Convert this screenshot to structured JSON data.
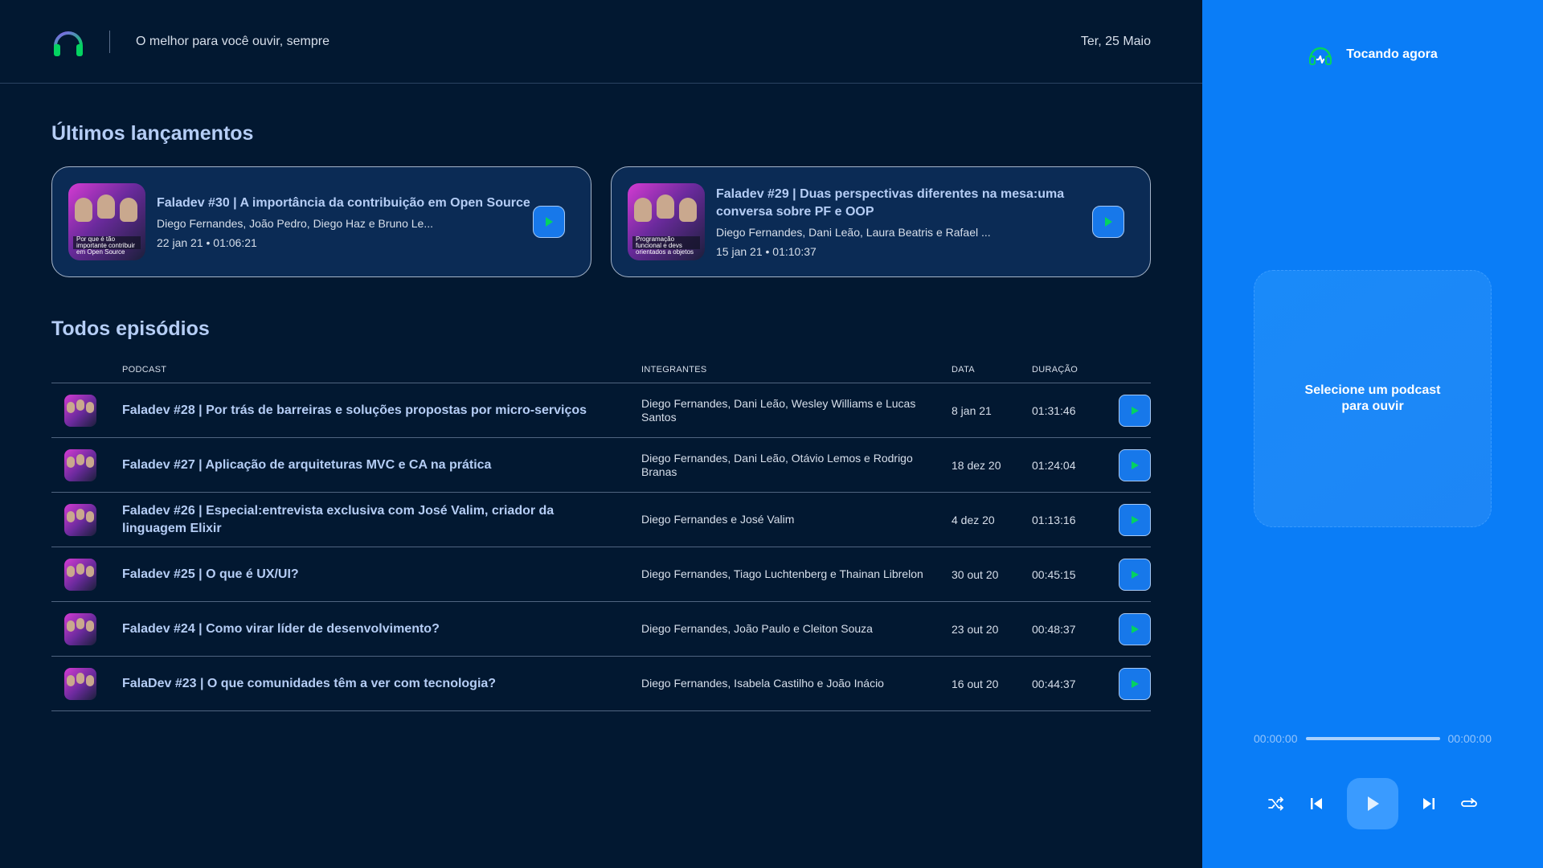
{
  "header": {
    "slogan": "O melhor para você ouvir, sempre",
    "date": "Ter, 25 Maio"
  },
  "latest": {
    "title": "Últimos lançamentos",
    "episodes": [
      {
        "title": "Faladev #30 | A importância da contribuição em Open Source",
        "members": "Diego Fernandes, João Pedro, Diego Haz e Bruno Le...",
        "meta": "22 jan 21 • 01:06:21",
        "thumb_caption": "Por que é tão importante contribuir em Open Source"
      },
      {
        "title": "Faladev #29 | Duas perspectivas diferentes na mesa:uma conversa sobre PF e OOP",
        "members": "Diego Fernandes, Dani Leão, Laura Beatris e Rafael ...",
        "meta": "15 jan 21 • 01:10:37",
        "thumb_caption": "Programação funcional e devs orientados a objetos"
      }
    ]
  },
  "all": {
    "title": "Todos episódios",
    "columns": [
      "PODCAST",
      "INTEGRANTES",
      "DATA",
      "DURAÇÃO"
    ],
    "rows": [
      {
        "title": "Faladev #28 | Por trás de barreiras e soluções propostas por micro-serviços",
        "members": "Diego Fernandes, Dani Leão, Wesley Williams e Lucas Santos",
        "date": "8 jan 21",
        "duration": "01:31:46"
      },
      {
        "title": "Faladev #27 | Aplicação de arquiteturas MVC e CA na prática",
        "members": "Diego Fernandes, Dani Leão, Otávio Lemos e Rodrigo Branas",
        "date": "18 dez 20",
        "duration": "01:24:04"
      },
      {
        "title": "Faladev #26 | Especial:entrevista exclusiva com José Valim, criador da linguagem Elixir",
        "members": "Diego Fernandes e José Valim",
        "date": "4 dez 20",
        "duration": "01:13:16"
      },
      {
        "title": "Faladev #25 | O que é UX/UI?",
        "members": "Diego Fernandes, Tiago Luchtenberg e Thainan Librelon",
        "date": "30 out 20",
        "duration": "00:45:15"
      },
      {
        "title": "Faladev #24 | Como virar líder de desenvolvimento?",
        "members": "Diego Fernandes, João Paulo e Cleiton Souza",
        "date": "23 out 20",
        "duration": "00:48:37"
      },
      {
        "title": "FalaDev #23 | O que comunidades têm a ver com tecnologia?",
        "members": "Diego Fernandes, Isabela Castilho e João Inácio",
        "date": "16 out 20",
        "duration": "00:44:37"
      }
    ]
  },
  "player": {
    "title": "Tocando agora",
    "empty_message": "Selecione um podcast para ouvir",
    "current_time": "00:00:00",
    "total_time": "00:00:00",
    "progress": 0
  },
  "colors": {
    "background": "#021831",
    "accent": "#0a7df7",
    "play_icon": "#04d361",
    "heading": "#b5cdf5"
  },
  "icons": [
    "headphones-logo-icon",
    "play-icon",
    "now-playing-icon",
    "shuffle-icon",
    "previous-icon",
    "next-icon",
    "repeat-icon"
  ]
}
